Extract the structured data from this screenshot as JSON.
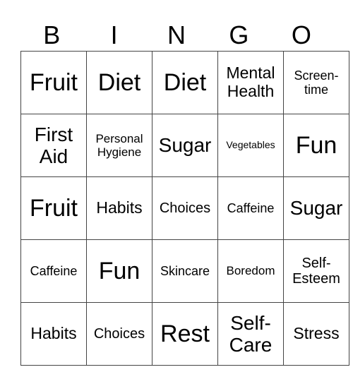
{
  "header": [
    "B",
    "I",
    "N",
    "G",
    "O"
  ],
  "rows": [
    [
      "Fruit",
      "Diet",
      "Diet",
      "Mental Health",
      "Screen-time"
    ],
    [
      "First Aid",
      "Personal Hygiene",
      "Sugar",
      "Vegetables",
      "Fun"
    ],
    [
      "Fruit",
      "Habits",
      "Choices",
      "Caffeine",
      "Sugar"
    ],
    [
      "Caffeine",
      "Fun",
      "Skincare",
      "Boredom",
      "Self-Esteem"
    ],
    [
      "Habits",
      "Choices",
      "Rest",
      "Self-Care",
      "Stress"
    ]
  ]
}
